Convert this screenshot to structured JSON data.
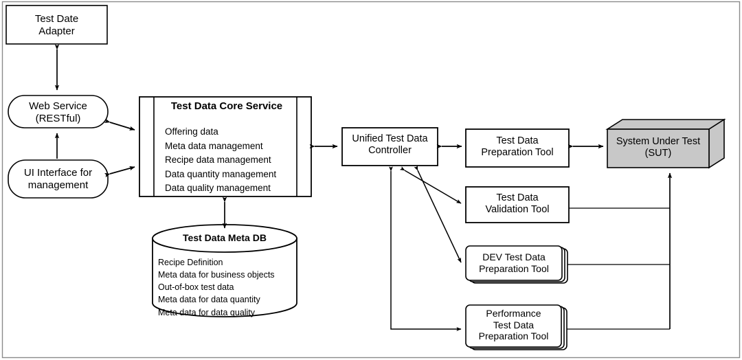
{
  "diagram": {
    "title_present": false,
    "border_color": "#8a8a8a",
    "line_color": "#000000",
    "sut_fill": "#c8c8c8",
    "nodes": {
      "test_date_adapter": {
        "label": "Test Date\nAdapter",
        "shape": "rect"
      },
      "web_service": {
        "label": "Web Service\n(RESTful)",
        "shape": "rounded"
      },
      "ui_interface": {
        "label": "UI Interface for\nmanagement",
        "shape": "rounded"
      },
      "core_service": {
        "title": "Test Data Core Service",
        "items": [
          "Offering data",
          "Meta data management",
          "Recipe data management",
          "Data quantity management",
          "Data quality management"
        ],
        "shape": "component"
      },
      "meta_db": {
        "title": "Test Data Meta DB",
        "items": [
          "Recipe Definition",
          "Meta data for business objects",
          "Out-of-box test data",
          "Meta data for data quantity",
          "Meta data for data quality"
        ],
        "shape": "cylinder"
      },
      "controller": {
        "label": "Unified Test Data\nController",
        "shape": "rect"
      },
      "prep_tool": {
        "label": "Test Data\nPreparation Tool",
        "shape": "rect"
      },
      "validation_tool": {
        "label": "Test Data\nValidation Tool",
        "shape": "rect"
      },
      "dev_prep_tool": {
        "label": "DEV Test Data\nPreparation Tool",
        "shape": "stacked"
      },
      "perf_prep_tool": {
        "label": "Performance\nTest Data\nPreparation Tool",
        "shape": "stacked"
      },
      "sut": {
        "label": "System Under Test\n(SUT)",
        "shape": "cuboid"
      }
    },
    "edges": [
      {
        "from": "test_date_adapter",
        "to": "web_service",
        "arrows": "both"
      },
      {
        "from": "ui_interface",
        "to": "web_service",
        "arrows": "to"
      },
      {
        "from": "web_service",
        "to": "core_service",
        "arrows": "both"
      },
      {
        "from": "ui_interface",
        "to": "core_service",
        "arrows": "both"
      },
      {
        "from": "core_service",
        "to": "meta_db",
        "arrows": "both"
      },
      {
        "from": "core_service",
        "to": "controller",
        "arrows": "both"
      },
      {
        "from": "controller",
        "to": "prep_tool",
        "arrows": "both"
      },
      {
        "from": "controller",
        "to": "validation_tool",
        "arrows": "both"
      },
      {
        "from": "controller",
        "to": "dev_prep_tool",
        "arrows": "both"
      },
      {
        "from": "controller",
        "to": "perf_prep_tool",
        "arrows": "both"
      },
      {
        "from": "prep_tool",
        "to": "sut",
        "arrows": "both"
      },
      {
        "from": "validation_tool",
        "to": "sut",
        "arrows": "to"
      },
      {
        "from": "dev_prep_tool",
        "to": "sut",
        "arrows": "to"
      },
      {
        "from": "perf_prep_tool",
        "to": "sut",
        "arrows": "to"
      }
    ]
  }
}
